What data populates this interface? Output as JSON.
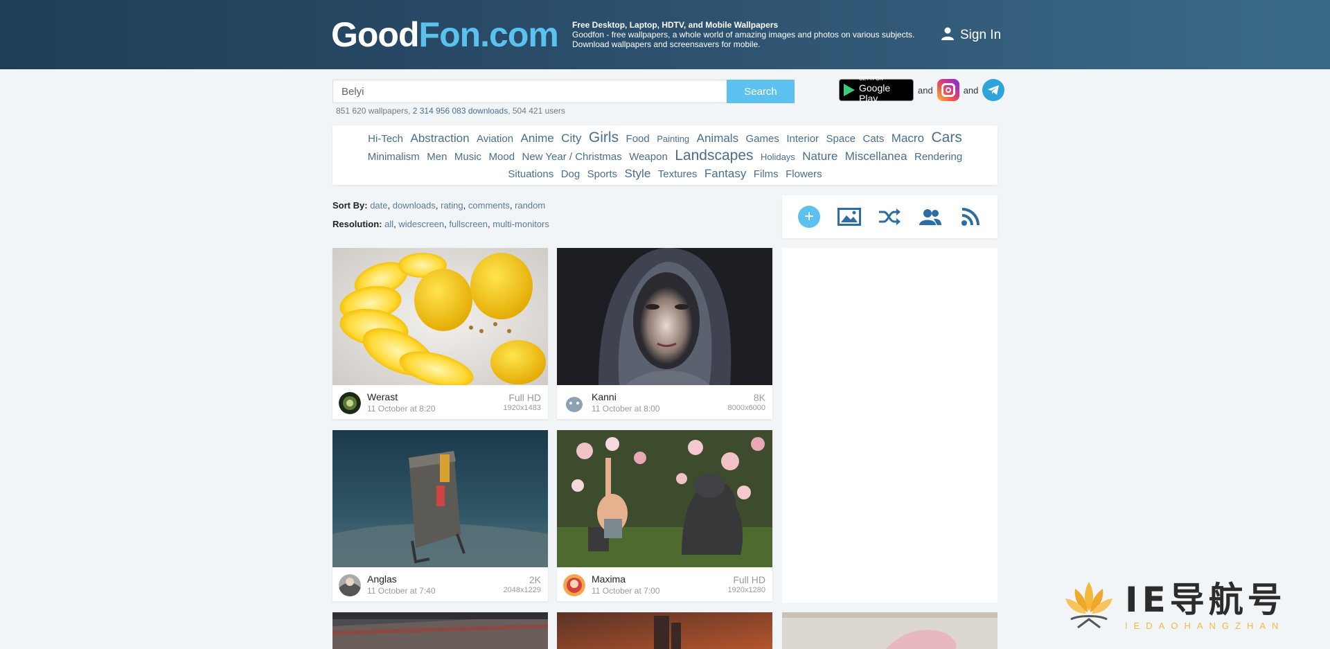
{
  "header": {
    "logo_part1": "Good",
    "logo_part2": "Fon.com",
    "tagline_title": "Free Desktop, Laptop, HDTV, and Mobile Wallpapers",
    "tagline_line1": "Goodfon - free wallpapers, a whole world of amazing images and photos on various subjects.",
    "tagline_line2": "Download wallpapers and screensavers for mobile.",
    "signin_label": "Sign In"
  },
  "search": {
    "value": "Belyi",
    "button_label": "Search"
  },
  "stats": {
    "wallpapers": "851 620 wallpapers, ",
    "downloads": "2 314 956 083 downloads",
    "users": ", 504 421 users"
  },
  "apps": {
    "gplay_small": "GET IT ON",
    "gplay_big": "Google Play",
    "and1": "and",
    "and2": "and"
  },
  "categories": [
    {
      "label": "Hi-Tech",
      "size": "s2"
    },
    {
      "label": "Abstraction",
      "size": "s3"
    },
    {
      "label": "Aviation",
      "size": "s2"
    },
    {
      "label": "Anime",
      "size": "s3"
    },
    {
      "label": "City",
      "size": "s3"
    },
    {
      "label": "Girls",
      "size": "s4"
    },
    {
      "label": "Food",
      "size": "s2"
    },
    {
      "label": "Painting",
      "size": "s1"
    },
    {
      "label": "Animals",
      "size": "s3"
    },
    {
      "label": "Games",
      "size": "s2"
    },
    {
      "label": "Interior",
      "size": "s2"
    },
    {
      "label": "Space",
      "size": "s2"
    },
    {
      "label": "Cats",
      "size": "s2"
    },
    {
      "label": "Macro",
      "size": "s3"
    },
    {
      "label": "Cars",
      "size": "s4"
    },
    {
      "label": "Minimalism",
      "size": "s2"
    },
    {
      "label": "Men",
      "size": "s2"
    },
    {
      "label": "Music",
      "size": "s2"
    },
    {
      "label": "Mood",
      "size": "s2"
    },
    {
      "label": "New Year / Christmas",
      "size": "s2"
    },
    {
      "label": "Weapon",
      "size": "s2"
    },
    {
      "label": "Landscapes",
      "size": "s4"
    },
    {
      "label": "Holidays",
      "size": "s1"
    },
    {
      "label": "Nature",
      "size": "s3"
    },
    {
      "label": "Miscellanea",
      "size": "s3"
    },
    {
      "label": "Rendering",
      "size": "s2"
    },
    {
      "label": "Situations",
      "size": "s2"
    },
    {
      "label": "Dog",
      "size": "s2"
    },
    {
      "label": "Sports",
      "size": "s2"
    },
    {
      "label": "Style",
      "size": "s3"
    },
    {
      "label": "Textures",
      "size": "s2"
    },
    {
      "label": "Fantasy",
      "size": "s3"
    },
    {
      "label": "Films",
      "size": "s2"
    },
    {
      "label": "Flowers",
      "size": "s2"
    }
  ],
  "sort": {
    "label": "Sort By:",
    "options": [
      "date",
      "downloads",
      "rating",
      "comments",
      "random"
    ]
  },
  "resolution": {
    "label": "Resolution:",
    "options": [
      "all",
      "widescreen",
      "fullscreen",
      "multi-monitors"
    ]
  },
  "toolbar": {
    "icons": [
      "plus-icon",
      "image-icon",
      "shuffle-icon",
      "users-icon",
      "rss-icon"
    ],
    "accent": "#5cc1ef",
    "icon_color": "#2b6ea3"
  },
  "cards": [
    {
      "user": "Werast",
      "date": "11 October at 8:20",
      "res": "Full HD",
      "dim": "1920x1483"
    },
    {
      "user": "Kanni",
      "date": "11 October at 8:00",
      "res": "8K",
      "dim": "8000x6000"
    },
    {
      "user": "Anglas",
      "date": "11 October at 7:40",
      "res": "2K",
      "dim": "2048x1229"
    },
    {
      "user": "Maxima",
      "date": "11 October at 7:00",
      "res": "Full HD",
      "dim": "1920x1280"
    }
  ],
  "watermark": {
    "text": "IE导航号",
    "sub": "IEDAOHANGZHAN"
  },
  "colors": {
    "header_dark": "#1f3d57",
    "logo_blue": "#5bc2ef",
    "link": "#4a6e8e"
  }
}
